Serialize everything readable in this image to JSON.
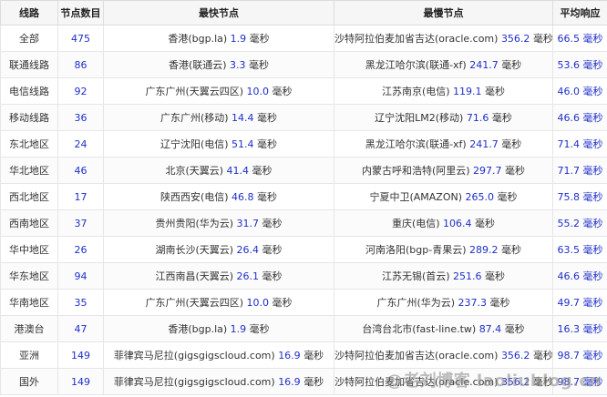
{
  "headers": [
    "线路",
    "节点数目",
    "最快节点",
    "最慢节点",
    "平均响应"
  ],
  "unit": "毫秒",
  "rows": [
    {
      "region": "全部",
      "count": "475",
      "fast_name": "香港(bgp.la)",
      "fast_ms": "1.9",
      "slow_name": "沙特阿拉伯麦加省吉达(oracle.com)",
      "slow_ms": "356.2",
      "avg": "66.5 毫秒"
    },
    {
      "region": "联通线路",
      "count": "86",
      "fast_name": "香港(联通云)",
      "fast_ms": "3.3",
      "slow_name": "黑龙江哈尔滨(联通-xf)",
      "slow_ms": "241.7",
      "avg": "53.6 毫秒"
    },
    {
      "region": "电信线路",
      "count": "92",
      "fast_name": "广东广州(天翼云四区)",
      "fast_ms": "10.0",
      "slow_name": "江苏南京(电信)",
      "slow_ms": "119.1",
      "avg": "46.0 毫秒"
    },
    {
      "region": "移动线路",
      "count": "36",
      "fast_name": "广东广州(移动)",
      "fast_ms": "14.4",
      "slow_name": "辽宁沈阳LM2(移动)",
      "slow_ms": "71.6",
      "avg": "46.6 毫秒"
    },
    {
      "region": "东北地区",
      "count": "24",
      "fast_name": "辽宁沈阳(电信)",
      "fast_ms": "51.4",
      "slow_name": "黑龙江哈尔滨(联通-xf)",
      "slow_ms": "241.7",
      "avg": "71.4 毫秒"
    },
    {
      "region": "华北地区",
      "count": "46",
      "fast_name": "北京(天翼云)",
      "fast_ms": "41.4",
      "slow_name": "内蒙古呼和浩特(阿里云)",
      "slow_ms": "297.7",
      "avg": "71.7 毫秒"
    },
    {
      "region": "西北地区",
      "count": "17",
      "fast_name": "陕西西安(电信)",
      "fast_ms": "46.8",
      "slow_name": "宁夏中卫(AMAZON)",
      "slow_ms": "265.0",
      "avg": "75.8 毫秒"
    },
    {
      "region": "西南地区",
      "count": "37",
      "fast_name": "贵州贵阳(华为云)",
      "fast_ms": "31.7",
      "slow_name": "重庆(电信)",
      "slow_ms": "106.4",
      "avg": "55.2 毫秒"
    },
    {
      "region": "华中地区",
      "count": "26",
      "fast_name": "湖南长沙(天翼云)",
      "fast_ms": "26.4",
      "slow_name": "河南洛阳(bgp-青果云)",
      "slow_ms": "289.2",
      "avg": "63.5 毫秒"
    },
    {
      "region": "华东地区",
      "count": "94",
      "fast_name": "江西南昌(天翼云)",
      "fast_ms": "26.1",
      "slow_name": "江苏无锡(首云)",
      "slow_ms": "251.6",
      "avg": "46.6 毫秒"
    },
    {
      "region": "华南地区",
      "count": "35",
      "fast_name": "广东广州(天翼云四区)",
      "fast_ms": "10.0",
      "slow_name": "广东广州(华为云)",
      "slow_ms": "237.3",
      "avg": "49.7 毫秒"
    },
    {
      "region": "港澳台",
      "count": "47",
      "fast_name": "香港(bgp.la)",
      "fast_ms": "1.9",
      "slow_name": "台湾台北市(fast-line.tw)",
      "slow_ms": "87.4",
      "avg": "16.3 毫秒"
    },
    {
      "region": "亚洲",
      "count": "149",
      "fast_name": "菲律宾马尼拉(gigsgigscloud.com)",
      "fast_ms": "16.9",
      "slow_name": "沙特阿拉伯麦加省吉达(oracle.com)",
      "slow_ms": "356.2",
      "avg": "98.7 毫秒"
    },
    {
      "region": "国外",
      "count": "149",
      "fast_name": "菲律宾马尼拉(gigsgigscloud.com)",
      "fast_ms": "16.9",
      "slow_name": "沙特阿拉伯麦加省吉达(oracle.com)",
      "slow_ms": "356.2",
      "avg": "98.7 毫秒"
    }
  ],
  "watermark": "@老刘博客 laoliublog.cn"
}
